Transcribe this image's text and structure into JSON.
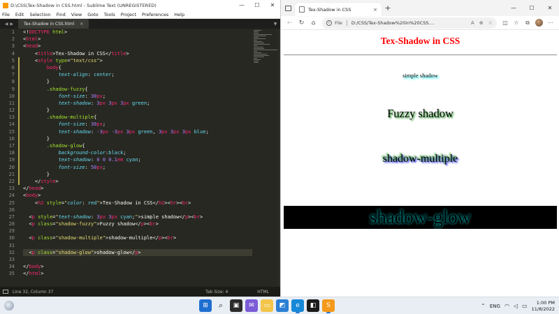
{
  "editor": {
    "window_title": "D:\\CSS\\Tex-Shadow in CSS.html - Sublime Text (UNREGISTERED)",
    "menu": [
      "File",
      "Edit",
      "Selection",
      "Find",
      "View",
      "Goto",
      "Tools",
      "Project",
      "Preferences",
      "Help"
    ],
    "tab_name": "Tex-Shadow in CSS.html",
    "tab_close": "×",
    "win_minimize": "—",
    "win_maximize": "☐",
    "win_close": "✕",
    "status_left": "Line 32, Column 37",
    "status_tab_size": "Tab Size: 4",
    "status_syntax": "HTML",
    "current_line": 32,
    "lines": [
      [
        [
          "k-text",
          "&lt;!"
        ],
        [
          "k-tag",
          "DOCTYPE"
        ],
        [
          "k-text",
          " "
        ],
        [
          "k-attr",
          "html"
        ],
        [
          "k-text",
          "&gt;"
        ]
      ],
      [
        [
          "k-text",
          "&lt;"
        ],
        [
          "k-tag",
          "html"
        ],
        [
          "k-text",
          "&gt;"
        ]
      ],
      [
        [
          "k-text",
          "&lt;"
        ],
        [
          "k-tag",
          "head"
        ],
        [
          "k-text",
          "&gt;"
        ]
      ],
      [
        [
          "k-text",
          "    &lt;"
        ],
        [
          "k-tag",
          "title"
        ],
        [
          "k-text",
          "&gt;Tex-Shadow in CSS&lt;/"
        ],
        [
          "k-tag",
          "title"
        ],
        [
          "k-text",
          "&gt;"
        ]
      ],
      [
        [
          "k-text",
          "    &lt;"
        ],
        [
          "k-tag",
          "style"
        ],
        [
          "k-text",
          " "
        ],
        [
          "k-attr",
          "type"
        ],
        [
          "k-text",
          "="
        ],
        [
          "k-str",
          "\"text/css\""
        ],
        [
          "k-text",
          "&gt;"
        ]
      ],
      [
        [
          "k-text",
          "        "
        ],
        [
          "k-tag",
          "body"
        ],
        [
          "k-text",
          "{"
        ]
      ],
      [
        [
          "k-text",
          "            "
        ],
        [
          "k-prop",
          "text-align"
        ],
        [
          "k-text",
          ": "
        ],
        [
          "k-val",
          "center"
        ],
        [
          "k-text",
          ";"
        ]
      ],
      [
        [
          "k-text",
          "        }"
        ]
      ],
      [
        [
          "k-text",
          "        "
        ],
        [
          "k-sel",
          ".shadow-fuzzy"
        ],
        [
          "k-text",
          "{"
        ]
      ],
      [
        [
          "k-text",
          "            "
        ],
        [
          "k-prop",
          "font-size"
        ],
        [
          "k-text",
          ": "
        ],
        [
          "k-num",
          "30"
        ],
        [
          "k-unit",
          "px"
        ],
        [
          "k-text",
          ";"
        ]
      ],
      [
        [
          "k-text",
          "            "
        ],
        [
          "k-prop",
          "text-shadow"
        ],
        [
          "k-text",
          ": "
        ],
        [
          "k-num",
          "3"
        ],
        [
          "k-unit",
          "px"
        ],
        [
          "k-text",
          " "
        ],
        [
          "k-num",
          "3"
        ],
        [
          "k-unit",
          "px"
        ],
        [
          "k-text",
          " "
        ],
        [
          "k-num",
          "3"
        ],
        [
          "k-unit",
          "px"
        ],
        [
          "k-text",
          " "
        ],
        [
          "k-val",
          "green"
        ],
        [
          "k-text",
          ";"
        ]
      ],
      [
        [
          "k-text",
          "        }"
        ]
      ],
      [
        [
          "k-text",
          "        "
        ],
        [
          "k-sel",
          ".shadow-multiple"
        ],
        [
          "k-text",
          "{"
        ]
      ],
      [
        [
          "k-text",
          "            "
        ],
        [
          "k-prop",
          "font-size"
        ],
        [
          "k-text",
          ": "
        ],
        [
          "k-num",
          "30"
        ],
        [
          "k-unit",
          "px"
        ],
        [
          "k-text",
          ";"
        ]
      ],
      [
        [
          "k-text",
          "            "
        ],
        [
          "k-prop",
          "text-shadow"
        ],
        [
          "k-text",
          ": "
        ],
        [
          "k-num",
          "-3"
        ],
        [
          "k-unit",
          "px"
        ],
        [
          "k-text",
          " "
        ],
        [
          "k-num",
          "-3"
        ],
        [
          "k-unit",
          "px"
        ],
        [
          "k-text",
          " "
        ],
        [
          "k-num",
          "3"
        ],
        [
          "k-unit",
          "px"
        ],
        [
          "k-text",
          " "
        ],
        [
          "k-val",
          "green"
        ],
        [
          "k-text",
          ", "
        ],
        [
          "k-num",
          "3"
        ],
        [
          "k-unit",
          "px"
        ],
        [
          "k-text",
          " "
        ],
        [
          "k-num",
          "3"
        ],
        [
          "k-unit",
          "px"
        ],
        [
          "k-text",
          " "
        ],
        [
          "k-num",
          "3"
        ],
        [
          "k-unit",
          "px"
        ],
        [
          "k-text",
          " "
        ],
        [
          "k-val",
          "blue"
        ],
        [
          "k-text",
          ";"
        ]
      ],
      [
        [
          "k-text",
          "        }"
        ]
      ],
      [
        [
          "k-text",
          "        "
        ],
        [
          "k-sel",
          ".shadow-glow"
        ],
        [
          "k-text",
          "{"
        ]
      ],
      [
        [
          "k-text",
          "            "
        ],
        [
          "k-prop",
          "background-color"
        ],
        [
          "k-text",
          ":"
        ],
        [
          "k-val",
          "black"
        ],
        [
          "k-text",
          ";"
        ]
      ],
      [
        [
          "k-text",
          "            "
        ],
        [
          "k-prop",
          "text-shadow"
        ],
        [
          "k-text",
          ": "
        ],
        [
          "k-num",
          "0"
        ],
        [
          "k-text",
          " "
        ],
        [
          "k-num",
          "0"
        ],
        [
          "k-text",
          " "
        ],
        [
          "k-num",
          "0.1"
        ],
        [
          "k-unit",
          "em"
        ],
        [
          "k-text",
          " "
        ],
        [
          "k-val",
          "cyan"
        ],
        [
          "k-text",
          ";"
        ]
      ],
      [
        [
          "k-text",
          "            "
        ],
        [
          "k-prop",
          "font-size"
        ],
        [
          "k-text",
          ": "
        ],
        [
          "k-num",
          "50"
        ],
        [
          "k-unit",
          "px"
        ],
        [
          "k-text",
          ";"
        ]
      ],
      [
        [
          "k-text",
          "        }"
        ]
      ],
      [
        [
          "k-text",
          "    &lt;/"
        ],
        [
          "k-tag",
          "style"
        ],
        [
          "k-text",
          "&gt;"
        ]
      ],
      [
        [
          "k-text",
          "&lt;/"
        ],
        [
          "k-tag",
          "head"
        ],
        [
          "k-text",
          "&gt;"
        ]
      ],
      [
        [
          "k-text",
          "&lt;"
        ],
        [
          "k-tag",
          "body"
        ],
        [
          "k-text",
          "&gt;"
        ]
      ],
      [
        [
          "k-text",
          "    &lt;"
        ],
        [
          "k-tag",
          "h2"
        ],
        [
          "k-text",
          " "
        ],
        [
          "k-attr",
          "style"
        ],
        [
          "k-text",
          "="
        ],
        [
          "k-str",
          "\""
        ],
        [
          "k-prop",
          "color"
        ],
        [
          "k-text",
          ": "
        ],
        [
          "k-val",
          "red"
        ],
        [
          "k-str",
          "\""
        ],
        [
          "k-text",
          "&gt;Tex-Shadow in CSS&lt;/"
        ],
        [
          "k-tag",
          "h2"
        ],
        [
          "k-text",
          "&gt;&lt;"
        ],
        [
          "k-tag",
          "hr"
        ],
        [
          "k-text",
          "&gt;&lt;"
        ],
        [
          "k-tag",
          "br"
        ],
        [
          "k-text",
          "&gt;"
        ]
      ],
      [],
      [
        [
          "k-text",
          "  &lt;"
        ],
        [
          "k-tag",
          "p"
        ],
        [
          "k-text",
          " "
        ],
        [
          "k-attr",
          "style"
        ],
        [
          "k-text",
          "="
        ],
        [
          "k-str",
          "\""
        ],
        [
          "k-prop",
          "text-shadow"
        ],
        [
          "k-text",
          ": "
        ],
        [
          "k-num",
          "3"
        ],
        [
          "k-unit",
          "px"
        ],
        [
          "k-text",
          " "
        ],
        [
          "k-num",
          "3"
        ],
        [
          "k-unit",
          "px"
        ],
        [
          "k-text",
          " "
        ],
        [
          "k-val",
          "cyan"
        ],
        [
          "k-text",
          ";"
        ],
        [
          "k-str",
          "\""
        ],
        [
          "k-text",
          "&gt;simple shadow&lt;/"
        ],
        [
          "k-tag",
          "p"
        ],
        [
          "k-text",
          "&gt;&lt;"
        ],
        [
          "k-tag",
          "br"
        ],
        [
          "k-text",
          "&gt;"
        ]
      ],
      [
        [
          "k-text",
          "  &lt;"
        ],
        [
          "k-tag",
          "p"
        ],
        [
          "k-text",
          " "
        ],
        [
          "k-attr",
          "class"
        ],
        [
          "k-text",
          "="
        ],
        [
          "k-str",
          "\"shadow-fuzzy\""
        ],
        [
          "k-text",
          "&gt;Fuzzy shadow&lt;/"
        ],
        [
          "k-tag",
          "p"
        ],
        [
          "k-text",
          "&gt;&lt;"
        ],
        [
          "k-tag",
          "br"
        ],
        [
          "k-text",
          "&gt;"
        ]
      ],
      [],
      [
        [
          "k-text",
          "  &lt;"
        ],
        [
          "k-tag",
          "p"
        ],
        [
          "k-text",
          " "
        ],
        [
          "k-attr",
          "class"
        ],
        [
          "k-text",
          "="
        ],
        [
          "k-str",
          "\"shadow-multiple\""
        ],
        [
          "k-text",
          "&gt;shadow-multiple&lt;/"
        ],
        [
          "k-tag",
          "p"
        ],
        [
          "k-text",
          "&gt;&lt;"
        ],
        [
          "k-tag",
          "br"
        ],
        [
          "k-text",
          "&gt;"
        ]
      ],
      [],
      [
        [
          "k-text",
          "  &lt;"
        ],
        [
          "k-tag",
          "p"
        ],
        [
          "k-text",
          " "
        ],
        [
          "k-attr",
          "class"
        ],
        [
          "k-text",
          "="
        ],
        [
          "k-str",
          "\"shadow-glow\""
        ],
        [
          "k-text",
          "&gt;shadow-glow&lt;/"
        ],
        [
          "k-tag",
          "p"
        ],
        [
          "k-text",
          "&gt;"
        ]
      ],
      [],
      [
        [
          "k-text",
          "&lt;/"
        ],
        [
          "k-tag",
          "body"
        ],
        [
          "k-text",
          "&gt;"
        ]
      ],
      [
        [
          "k-text",
          "&lt;/"
        ],
        [
          "k-tag",
          "html"
        ],
        [
          "k-text",
          "&gt;"
        ]
      ]
    ]
  },
  "browser": {
    "tab_title": "Tex-Shadow in CSS",
    "tab_close": "×",
    "new_tab": "+",
    "win_minimize": "—",
    "win_maximize": "☐",
    "win_close": "✕",
    "address_label": "File",
    "address_url": "D:/CSS/Tex-Shadow%20in%20CSS....",
    "page": {
      "heading": "Tex-Shadow in CSS",
      "simple": "simple shadow",
      "fuzzy": "Fuzzy shadow",
      "multiple": "shadow-multiple",
      "glow": "shadow-glow"
    }
  },
  "taskbar": {
    "time": "1:00 PM",
    "date": "11/8/2022",
    "lang": "ENG"
  },
  "colors": {
    "editor_bg": "#272822",
    "heading_red": "#ff0000",
    "glow_cyan": "#00ffff",
    "taskbar_bg": "#e9eef4"
  }
}
